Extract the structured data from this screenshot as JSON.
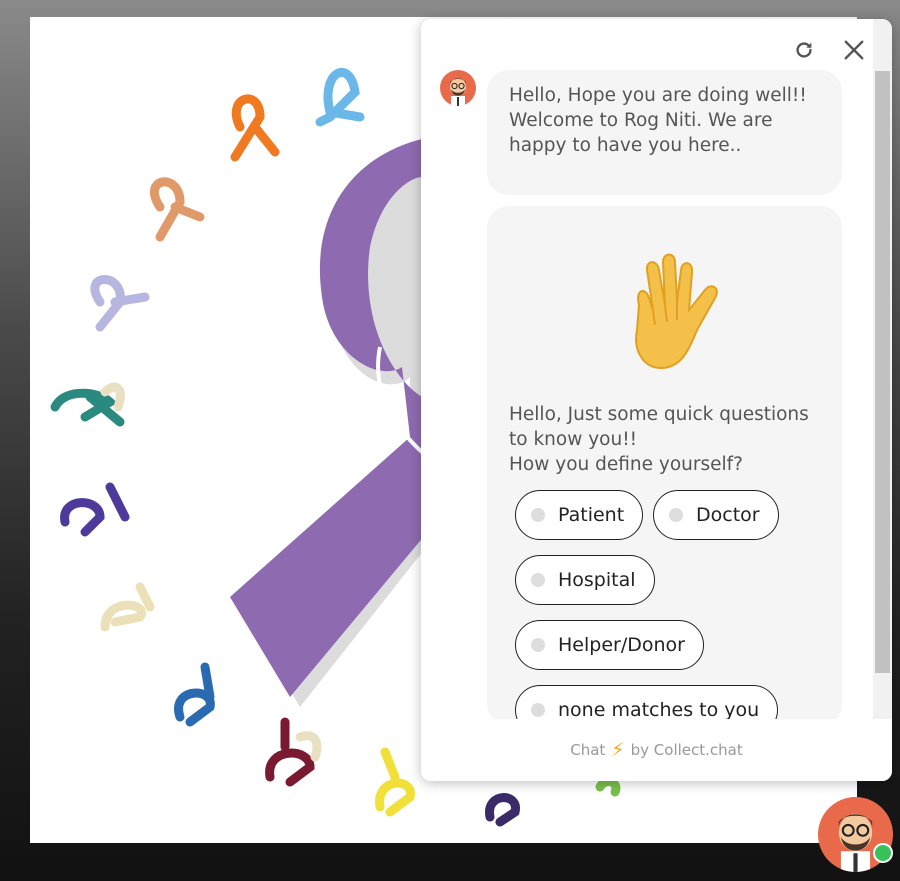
{
  "chat": {
    "greeting_lines": [
      "Hello, Hope you are doing well!!",
      "Welcome to Rog Niti. We are",
      "happy to have you here.."
    ],
    "question_lines": [
      "Hello, Just some quick questions",
      "to know you!!",
      "How you define yourself?"
    ],
    "wave_icon": "waving-hand-emoji",
    "options": [
      "Patient",
      "Doctor",
      "Hospital",
      "Helper/Donor",
      "none matches to you"
    ],
    "footer": {
      "prefix": "Chat",
      "bolt": "⚡",
      "suffix": "by Collect.chat"
    },
    "controls": {
      "refresh_icon": "refresh-icon",
      "close_icon": "close-icon"
    }
  },
  "colors": {
    "ribbon_purple": "#8e6bb0",
    "avatar_bg": "#e86a4a",
    "online": "#37c25a",
    "bolt": "#f5a623"
  }
}
